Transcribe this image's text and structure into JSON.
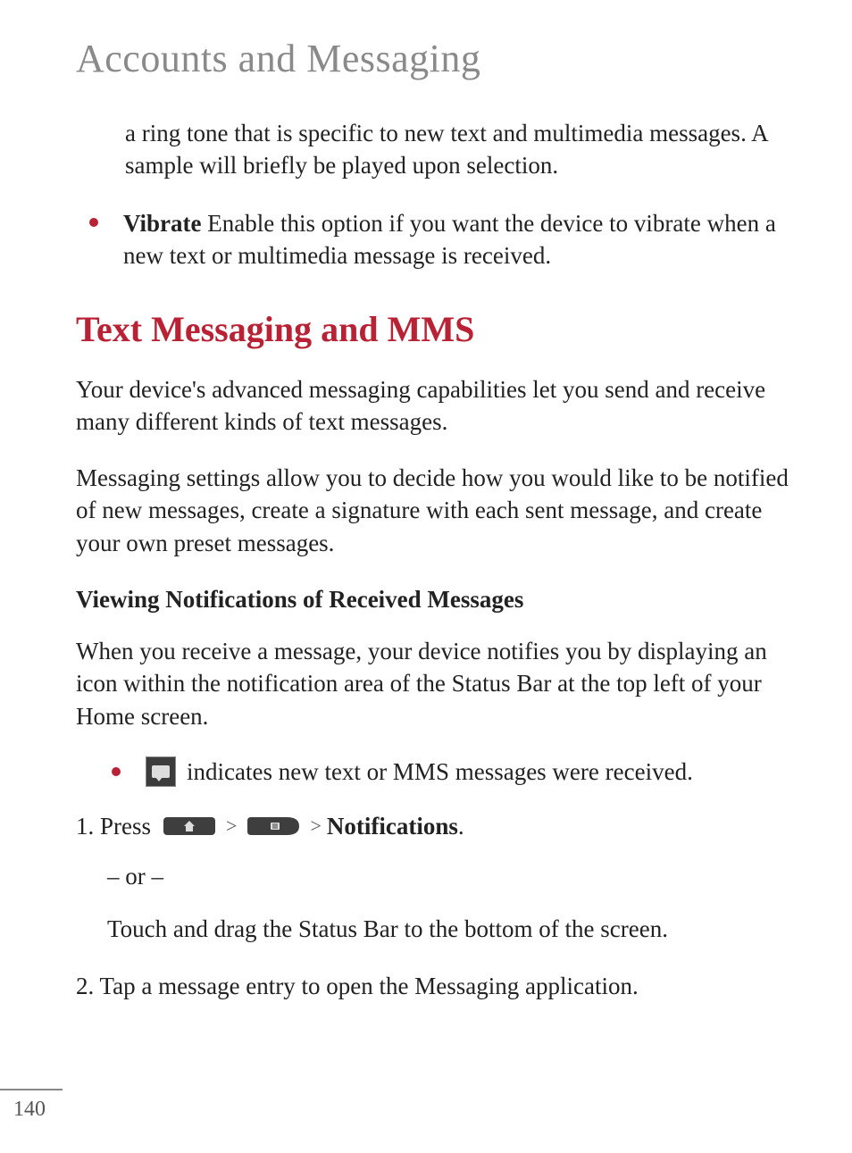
{
  "chapter_title": "Accounts and Messaging",
  "intro_fragment": "a ring tone that is specific to new text and multimedia messages. A sample will briefly be played upon selection.",
  "vibrate_label": "Vibrate",
  "vibrate_desc": " Enable this option if you want the device to vibrate when a new text or multimedia message is received.",
  "section_heading": "Text Messaging and MMS",
  "para1": "Your device's advanced messaging capabilities let you send and receive many different kinds of text messages.",
  "para2": "Messaging settings allow you to decide how you would like to be notified of new messages, create a signature with each sent message, and create your own preset messages.",
  "sub_heading": "Viewing Notifications of Received Messages",
  "para3": "When you receive a message, your device notifies you by displaying an icon within the notification area of the Status Bar at the top left of your Home screen.",
  "icon_bullet_text": "  indicates new text or MMS messages were received.",
  "step1_prefix": "1. Press ",
  "step1_sep": ">",
  "step1_notifications": "Notifications",
  "step1_period": ".",
  "or_text": "– or –",
  "touch_drag": "Touch and drag the Status Bar to the bottom of the screen.",
  "step2": "2. Tap a message entry to open the Messaging application.",
  "page_number": "140"
}
